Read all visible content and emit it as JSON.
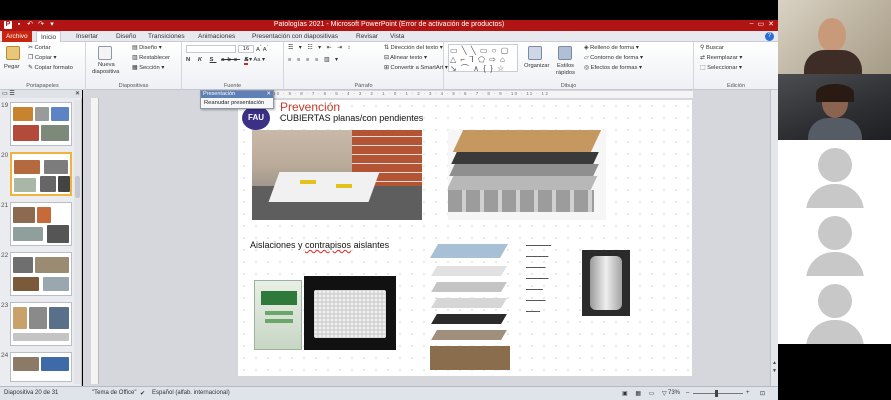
{
  "window": {
    "title": "Patologías 2021 - Microsoft PowerPoint (Error de activación de productos)",
    "controls": [
      "–",
      "▭",
      "✕"
    ]
  },
  "tabs": [
    {
      "label": "Archivo",
      "kind": "file"
    },
    {
      "label": "Inicio",
      "kind": "active"
    },
    {
      "label": "Insertar"
    },
    {
      "label": "Diseño"
    },
    {
      "label": "Transiciones"
    },
    {
      "label": "Animaciones"
    },
    {
      "label": "Presentación con diapositivas"
    },
    {
      "label": "Revisar"
    },
    {
      "label": "Vista"
    }
  ],
  "ribbon": {
    "clipboard": {
      "paste": "Pegar",
      "cut": "Cortar",
      "copy": "Copiar",
      "format_painter": "Copiar formato",
      "label": "Portapapeles"
    },
    "slides": {
      "new_slide_1": "Nueva",
      "new_slide_2": "diapositiva",
      "layout": "Diseño",
      "reset": "Restablecer",
      "section": "Sección",
      "label": "Diapositivas"
    },
    "font": {
      "size": "16",
      "label": "Fuente"
    },
    "paragraph": {
      "text_direction": "Dirección del texto",
      "align_text": "Alinear texto",
      "smartart": "Convertir a SmartArt",
      "label": "Párrafo"
    },
    "drawing": {
      "arrange": "Organizar",
      "styles_1": "Estilos",
      "styles_2": "rápidos",
      "fill": "Relleno de forma",
      "outline": "Contorno de forma",
      "effects": "Efectos de formas",
      "label": "Dibujo"
    },
    "editing": {
      "find": "Buscar",
      "replace": "Reemplazar",
      "select": "Seleccionar",
      "label": "Edición"
    }
  },
  "popup": {
    "title": "Presentación",
    "close": "✕",
    "item": "Reanudar presentación"
  },
  "thumbnails": [
    {
      "num": "19"
    },
    {
      "num": "20",
      "selected": true
    },
    {
      "num": "21"
    },
    {
      "num": "22"
    },
    {
      "num": "23"
    },
    {
      "num": "24"
    }
  ],
  "ruler": {
    "marks": "10 · 9 · 8 · 7 · 6 · 5 · 4 · 3 · 2 · 1 · 0 · 1 · 2 · 3 · 4 · 5 · 6 · 7 · 8 · 9 · 10 · 11 · 12"
  },
  "slide": {
    "logo": "FAU",
    "title": "Prevención",
    "subtitle": "CUBIERTAS planas/con pendientes",
    "section2_a": "Aislaciones y ",
    "section2_b": "contrapisos",
    "section2_c": " aislantes"
  },
  "statusbar": {
    "slide_info": "Diapositiva 20 de 31",
    "theme": "\"Tema de Office\"",
    "language": "Español (alfab. internacional)",
    "zoom": "73%"
  },
  "colors": {
    "titlebar": "#b01514",
    "file_tab": "#c8260f",
    "slide_title": "#c03b2b",
    "accent_blue": "#2a6fd6"
  }
}
